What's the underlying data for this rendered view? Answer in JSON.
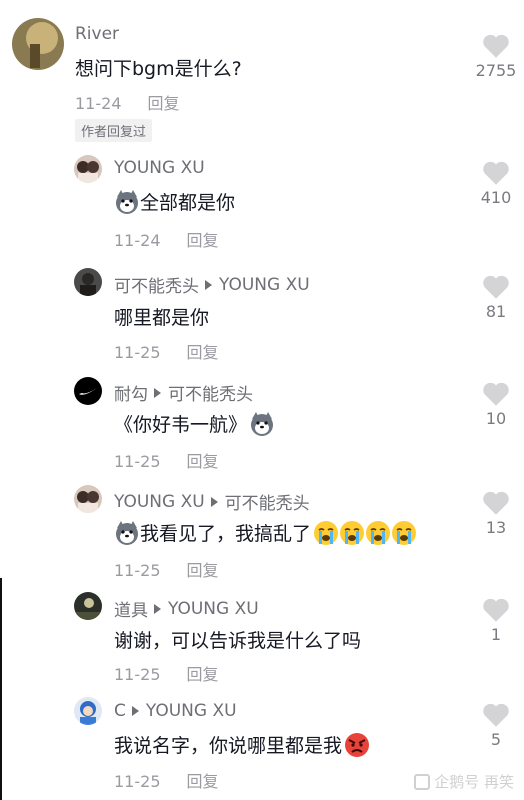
{
  "comments": [
    {
      "name": "River",
      "target": "",
      "text": "想问下bgm是什么?",
      "date": "11-24",
      "reply_label": "回复",
      "likes": "2755",
      "author_tag": "作者回复过"
    },
    {
      "name": "YOUNG XU",
      "target": "",
      "text": "全部都是你",
      "date": "11-24",
      "reply_label": "回复",
      "likes": "410"
    },
    {
      "name": "可不能秃头",
      "target": "YOUNG XU",
      "text": "哪里都是你",
      "date": "11-25",
      "reply_label": "回复",
      "likes": "81"
    },
    {
      "name": "耐勾",
      "target": "可不能秃头",
      "text": "《你好韦一航》",
      "date": "11-25",
      "reply_label": "回复",
      "likes": "10"
    },
    {
      "name": "YOUNG XU",
      "target": "可不能秃头",
      "text": "我看见了，我搞乱了",
      "date": "11-25",
      "reply_label": "回复",
      "likes": "13"
    },
    {
      "name": "道具",
      "target": "YOUNG XU",
      "text": "谢谢，可以告诉我是什么了吗",
      "date": "11-25",
      "reply_label": "回复",
      "likes": "1"
    },
    {
      "name": "C",
      "target": "YOUNG XU",
      "text": "我说名字，你说哪里都是我",
      "date": "11-25",
      "reply_label": "回复",
      "likes": "5"
    }
  ],
  "icons": {
    "like": "heart-icon",
    "husky": "husky-emoji-icon",
    "cry": "crying-emoji-icon",
    "angry": "angry-emoji-icon",
    "arrow": "reply-arrow-icon"
  },
  "colors": {
    "name": "#6e6f75",
    "text": "#161823",
    "meta": "#9a9ba1",
    "heart": "#d4d4d6"
  },
  "watermark": "企鹅号 再笑"
}
